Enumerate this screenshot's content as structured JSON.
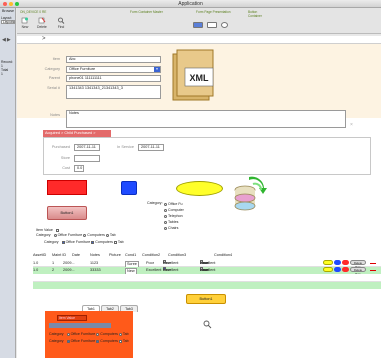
{
  "window": {
    "title": "Application"
  },
  "sidebar": {
    "browse_label": "Browse",
    "layout_label": "Layout:",
    "layout_value": "Layouts",
    "records_label": "Record:",
    "record_number": "1",
    "total_label": "Total",
    "total_value": "1"
  },
  "toolbar": {
    "badges": [
      "ON_DEVICE 0 RE",
      "Form Container Master",
      "Form Page Presentation",
      "Button Container"
    ],
    "buttons": [
      {
        "label": "New",
        "icon": "new-record-icon"
      },
      {
        "label": "Delete",
        "icon": "delete-record-icon"
      },
      {
        "label": "Find",
        "icon": "search-icon"
      }
    ]
  },
  "form": {
    "fields": [
      {
        "label": "Item",
        "value": "Abc"
      },
      {
        "label": "Category",
        "value": "Office Furniture"
      },
      {
        "label": "Parent",
        "value": "phone01    111111111"
      },
      {
        "label": "Serial #",
        "value": "1341343    1341343_21341343_3"
      },
      {
        "label": "Notes",
        "value": "Notes"
      }
    ],
    "xml_label": "XML"
  },
  "portal": {
    "tab_label": "Acquired > Child Purchased >",
    "purchased_label": "Purchased",
    "purchased_value": "2007-11-11",
    "inservice_label": "In Service",
    "inservice_value": "2007-11-11",
    "store_label": "Store",
    "store_value": "",
    "cost_label": "Cost",
    "cost_value": "0.0"
  },
  "controls": {
    "button_label": "Button1",
    "category_heading": "Category:",
    "category_options": [
      "Office Fu",
      "Computer",
      "Telephon",
      "Tables",
      "Chairs"
    ],
    "item_value_label": "Item Value",
    "radio_row_label": "Category",
    "radio_options": [
      "Office Furniture",
      "Computers",
      "Tab"
    ],
    "check_row_label": "Category",
    "check_options": [
      "Office Furniture",
      "Computers",
      "Tab"
    ]
  },
  "table": {
    "headers": [
      "AssetID",
      "Maint ID",
      "Date",
      "Notes",
      "Picture",
      "Cond1",
      "Condition2",
      "Condition3",
      "Condition4"
    ],
    "rows": [
      [
        "1.0",
        "1",
        "2009...",
        "1123",
        "",
        "Scree",
        "Poor",
        "New",
        "Excellent",
        "New",
        "Excellent",
        "Good",
        "Poor"
      ],
      [
        "1.0",
        "2",
        "2009...",
        "33333",
        "",
        "New",
        "Excellent",
        "New",
        "Excellent",
        "New",
        "Excellent",
        "Good",
        "Poor"
      ]
    ],
    "pill_label": "Delete Row"
  },
  "bottom": {
    "tabs": [
      "Tab1",
      "Tab2",
      "Tab3"
    ],
    "yellow_button": "Button1",
    "panel_field_label": "Item Value",
    "panel_radio_label": "Category",
    "panel_radio_options": [
      "Office Furniture",
      "Computers",
      "Tab"
    ],
    "panel_check_label": "Category",
    "panel_check_options": [
      "Office Furniture",
      "Computers",
      "Tab"
    ]
  },
  "colors": {
    "accent": "#3a63d3",
    "red": "#ff2a2a",
    "blue": "#1f4bff",
    "yellow": "#ffff2a",
    "orange": "#ff5a1a",
    "row_green": "#bff0c0"
  }
}
